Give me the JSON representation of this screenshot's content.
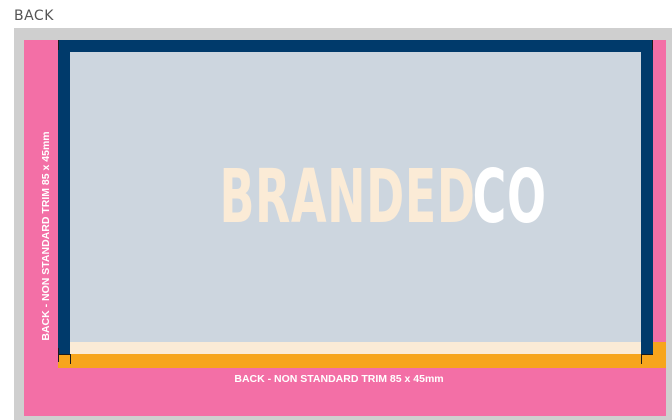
{
  "header": {
    "label": "BACK"
  },
  "card": {
    "logo_primary": "BRANDED",
    "logo_secondary": "CO",
    "trim_label_side": "BACK - NON STANDARD TRIM 85 x 45mm",
    "trim_label_bottom": "BACK - NON STANDARD TRIM 85 x 45mm"
  },
  "colors": {
    "bleed_pink": "#f36fa6",
    "safe_navy": "#003a6b",
    "accent_orange": "#f7a51c",
    "artwork_bg": "#cdd6df",
    "logo_cream": "#fbebd6",
    "logo_white": "#ffffff",
    "frame_gray": "#cfcfcf"
  }
}
